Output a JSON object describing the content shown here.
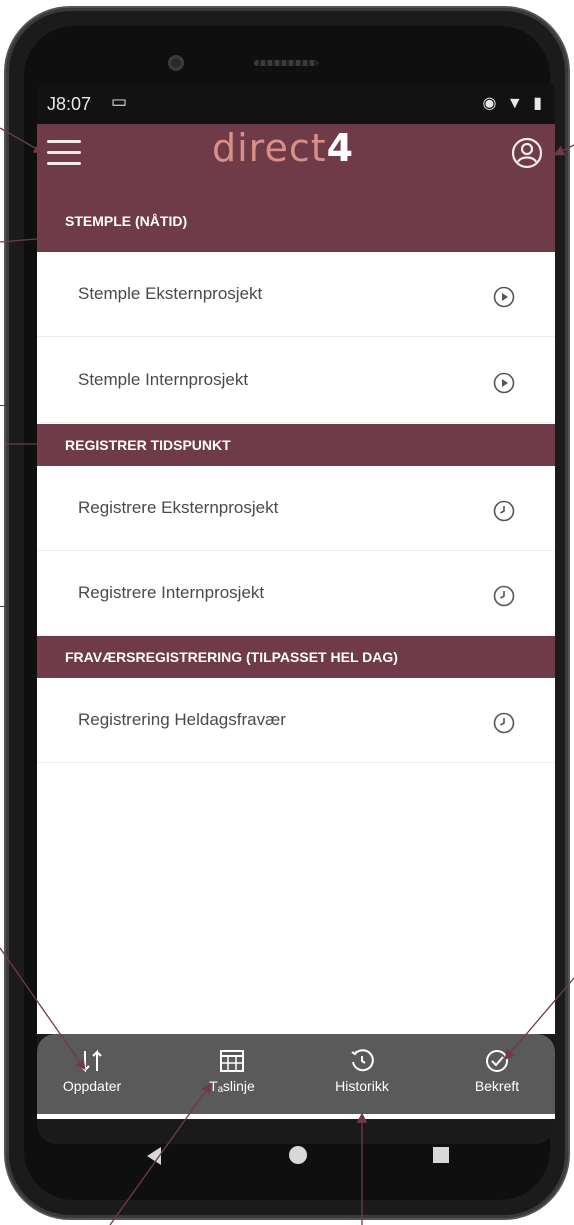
{
  "status_bar": {
    "time": "J8:07",
    "left_icon": "screen-cast-icon",
    "right_icons": "eye-icon wifi-icon battery-icon"
  },
  "app_bar": {
    "logo_text": "direct",
    "logo_suffix": "4"
  },
  "sections": [
    {
      "header": "STEMPLE (NÅTID)",
      "items": [
        {
          "label": "Stemple Eksternprosjekt",
          "icon": "play-circle-icon"
        },
        {
          "label": "Stemple Internprosjekt",
          "icon": "play-circle-icon"
        }
      ]
    },
    {
      "header": "REGISTRER TIDSPUNKT",
      "items": [
        {
          "label": "Registrere Eksternprosjekt",
          "icon": "clock-icon"
        },
        {
          "label": "Registrere Internprosjekt",
          "icon": "clock-icon"
        }
      ]
    },
    {
      "header": "FRAVÆRSREGISTRERING (TILPASSET HEL DAG)",
      "items": [
        {
          "label": "Registrering Heldagsfravær",
          "icon": "clock-icon"
        }
      ]
    }
  ],
  "bottom_nav": [
    {
      "label": "Oppdater",
      "icon": "sync-icon"
    },
    {
      "label": "Tₐslinje",
      "icon": "calendar-grid-icon"
    },
    {
      "label": "Historikk",
      "icon": "history-icon"
    },
    {
      "label": "Bekreft",
      "icon": "check-circle-icon"
    }
  ],
  "colors": {
    "accent": "#6f3b49",
    "logo": "#d88f86",
    "nav_bg": "#5a5a5a",
    "annotation_arrow": "#6f3b49"
  }
}
